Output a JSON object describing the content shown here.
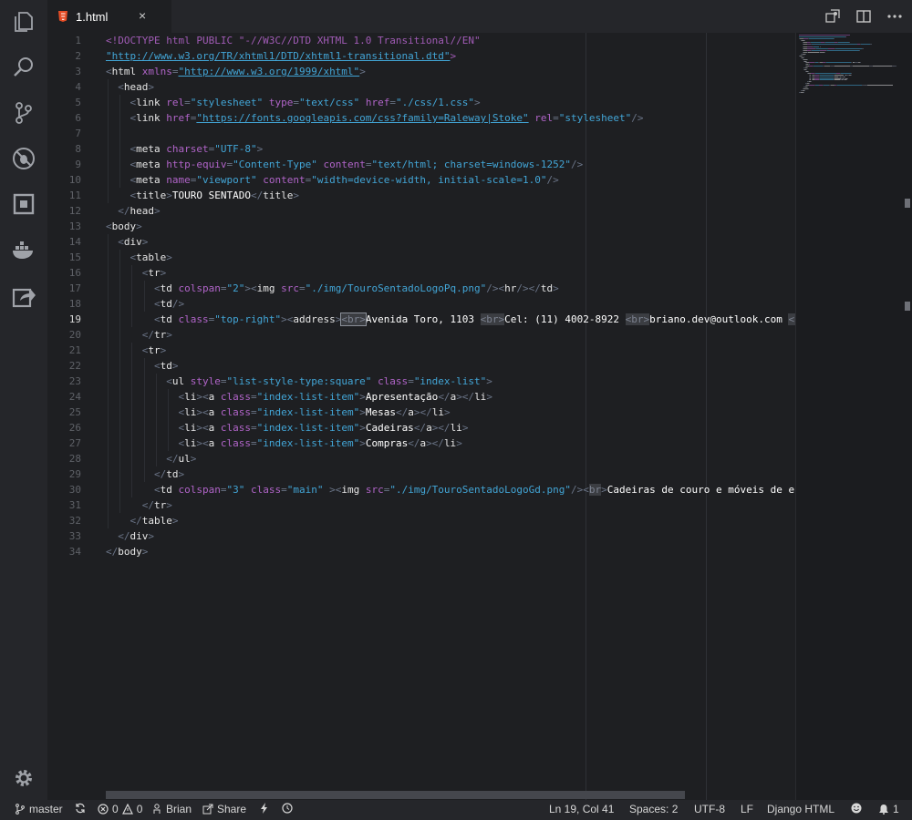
{
  "tab": {
    "label": "1.html",
    "close": "×"
  },
  "activity_icons": [
    "files-icon",
    "search-icon",
    "source-control-icon",
    "debug-icon",
    "extensions-icon",
    "docker-icon",
    "live-share-icon",
    "settings-gear-icon"
  ],
  "editor": {
    "active_line": 19,
    "line_numbers": [
      "1",
      "2",
      "3",
      "4",
      "5",
      "6",
      "7",
      "8",
      "9",
      "10",
      "11",
      "12",
      "13",
      "14",
      "15",
      "16",
      "17",
      "18",
      "19",
      "20",
      "21",
      "22",
      "23",
      "24",
      "25",
      "26",
      "27",
      "28",
      "29",
      "30",
      "31",
      "32",
      "33",
      "34"
    ],
    "lines": [
      [
        [
          "d",
          "<!DOCTYPE html PUBLIC \"-//W3C//DTD XHTML 1.0 Transitional//EN\""
        ]
      ],
      [
        [
          "u",
          "\"http://www.w3.org/TR/xhtml1/DTD/xhtml1-transitional.dtd\""
        ],
        [
          "d",
          ">"
        ]
      ],
      [
        [
          "t",
          "<"
        ],
        [
          "n",
          "html "
        ],
        [
          "a",
          "xmlns"
        ],
        [
          "t",
          "="
        ],
        [
          "u",
          "\"http://www.w3.org/1999/xhtml\""
        ],
        [
          "t",
          ">"
        ]
      ],
      [
        [
          "w",
          "  "
        ],
        [
          "t",
          "<"
        ],
        [
          "n",
          "head"
        ],
        [
          "t",
          ">"
        ]
      ],
      [
        [
          "w",
          "    "
        ],
        [
          "t",
          "<"
        ],
        [
          "n",
          "link "
        ],
        [
          "a",
          "rel"
        ],
        [
          "t",
          "="
        ],
        [
          "s",
          "\"stylesheet\" "
        ],
        [
          "a",
          "type"
        ],
        [
          "t",
          "="
        ],
        [
          "s",
          "\"text/css\" "
        ],
        [
          "a",
          "href"
        ],
        [
          "t",
          "="
        ],
        [
          "s",
          "\"./css/1.css\""
        ],
        [
          "t",
          ">"
        ]
      ],
      [
        [
          "w",
          "    "
        ],
        [
          "t",
          "<"
        ],
        [
          "n",
          "link "
        ],
        [
          "a",
          "href"
        ],
        [
          "t",
          "="
        ],
        [
          "u",
          "\"https://fonts.googleapis.com/css?family=Raleway|Stoke\""
        ],
        [
          "s",
          " "
        ],
        [
          "a",
          "rel"
        ],
        [
          "t",
          "="
        ],
        [
          "s",
          "\"stylesheet\""
        ],
        [
          "t",
          "/>"
        ]
      ],
      [],
      [
        [
          "w",
          "    "
        ],
        [
          "t",
          "<"
        ],
        [
          "n",
          "meta "
        ],
        [
          "a",
          "charset"
        ],
        [
          "t",
          "="
        ],
        [
          "s",
          "\"UTF-8\""
        ],
        [
          "t",
          ">"
        ]
      ],
      [
        [
          "w",
          "    "
        ],
        [
          "t",
          "<"
        ],
        [
          "n",
          "meta "
        ],
        [
          "a",
          "http-equiv"
        ],
        [
          "t",
          "="
        ],
        [
          "s",
          "\"Content-Type\" "
        ],
        [
          "a",
          "content"
        ],
        [
          "t",
          "="
        ],
        [
          "s",
          "\"text/html; charset=windows-1252\""
        ],
        [
          "t",
          "/>"
        ]
      ],
      [
        [
          "w",
          "    "
        ],
        [
          "t",
          "<"
        ],
        [
          "n",
          "meta "
        ],
        [
          "a",
          "name"
        ],
        [
          "t",
          "="
        ],
        [
          "s",
          "\"viewport\" "
        ],
        [
          "a",
          "content"
        ],
        [
          "t",
          "="
        ],
        [
          "s",
          "\"width=device-width, initial-scale=1.0\""
        ],
        [
          "t",
          "/>"
        ]
      ],
      [
        [
          "w",
          "    "
        ],
        [
          "t",
          "<"
        ],
        [
          "n",
          "title"
        ],
        [
          "t",
          ">"
        ],
        [
          "tx",
          "TOURO SENTADO"
        ],
        [
          "t",
          "</"
        ],
        [
          "n",
          "title"
        ],
        [
          "t",
          ">"
        ]
      ],
      [
        [
          "w",
          "  "
        ],
        [
          "t",
          "</"
        ],
        [
          "n",
          "head"
        ],
        [
          "t",
          ">"
        ]
      ],
      [
        [
          "t",
          "<"
        ],
        [
          "n",
          "body"
        ],
        [
          "t",
          ">"
        ]
      ],
      [
        [
          "w",
          "  "
        ],
        [
          "t",
          "<"
        ],
        [
          "n",
          "div"
        ],
        [
          "t",
          ">"
        ]
      ],
      [
        [
          "w",
          "    "
        ],
        [
          "t",
          "<"
        ],
        [
          "n",
          "table"
        ],
        [
          "t",
          ">"
        ]
      ],
      [
        [
          "w",
          "      "
        ],
        [
          "t",
          "<"
        ],
        [
          "n",
          "tr"
        ],
        [
          "t",
          ">"
        ]
      ],
      [
        [
          "w",
          "        "
        ],
        [
          "t",
          "<"
        ],
        [
          "n",
          "td "
        ],
        [
          "a",
          "colspan"
        ],
        [
          "t",
          "="
        ],
        [
          "s",
          "\"2\""
        ],
        [
          "t",
          ">"
        ],
        [
          "t",
          "<"
        ],
        [
          "n",
          "img "
        ],
        [
          "a",
          "src"
        ],
        [
          "t",
          "="
        ],
        [
          "s",
          "\"./img/TouroSentadoLogoPq.png\""
        ],
        [
          "t",
          "/>"
        ],
        [
          "t",
          "<"
        ],
        [
          "n",
          "hr"
        ],
        [
          "t",
          "/>"
        ],
        [
          "t",
          "</"
        ],
        [
          "n",
          "td"
        ],
        [
          "t",
          ">"
        ]
      ],
      [
        [
          "w",
          "        "
        ],
        [
          "t",
          "<"
        ],
        [
          "n",
          "td"
        ],
        [
          "t",
          "/>"
        ]
      ],
      [
        [
          "w",
          "        "
        ],
        [
          "t",
          "<"
        ],
        [
          "n",
          "td "
        ],
        [
          "a",
          "class"
        ],
        [
          "t",
          "="
        ],
        [
          "s",
          "\"top-right\""
        ],
        [
          "t",
          ">"
        ],
        [
          "t",
          "<"
        ],
        [
          "n",
          "address"
        ],
        [
          "t",
          ">"
        ],
        [
          "br2",
          "<br>"
        ],
        [
          "tx",
          "Avenida Toro, 1103 "
        ],
        [
          "br",
          "<br>"
        ],
        [
          "tx",
          "Cel: (11) 4002-8922 "
        ],
        [
          "br",
          "<br>"
        ],
        [
          "tx",
          "briano.dev@outlook.com "
        ],
        [
          "br",
          "<br>"
        ],
        [
          "t",
          "</"
        ]
      ],
      [
        [
          "w",
          "      "
        ],
        [
          "t",
          "</"
        ],
        [
          "n",
          "tr"
        ],
        [
          "t",
          ">"
        ]
      ],
      [
        [
          "w",
          "      "
        ],
        [
          "t",
          "<"
        ],
        [
          "n",
          "tr"
        ],
        [
          "t",
          ">"
        ]
      ],
      [
        [
          "w",
          "        "
        ],
        [
          "t",
          "<"
        ],
        [
          "n",
          "td"
        ],
        [
          "t",
          ">"
        ]
      ],
      [
        [
          "w",
          "          "
        ],
        [
          "t",
          "<"
        ],
        [
          "n",
          "ul "
        ],
        [
          "a",
          "style"
        ],
        [
          "t",
          "="
        ],
        [
          "s",
          "\"list-style-type:square\" "
        ],
        [
          "a",
          "class"
        ],
        [
          "t",
          "="
        ],
        [
          "s",
          "\"index-list\""
        ],
        [
          "t",
          ">"
        ]
      ],
      [
        [
          "w",
          "            "
        ],
        [
          "t",
          "<"
        ],
        [
          "n",
          "li"
        ],
        [
          "t",
          "><"
        ],
        [
          "n",
          "a "
        ],
        [
          "a",
          "class"
        ],
        [
          "t",
          "="
        ],
        [
          "s",
          "\"index-list-item\""
        ],
        [
          "t",
          ">"
        ],
        [
          "tx",
          "Apresentação"
        ],
        [
          "t",
          "</"
        ],
        [
          "n",
          "a"
        ],
        [
          "t",
          "></"
        ],
        [
          "n",
          "li"
        ],
        [
          "t",
          ">"
        ]
      ],
      [
        [
          "w",
          "            "
        ],
        [
          "t",
          "<"
        ],
        [
          "n",
          "li"
        ],
        [
          "t",
          "><"
        ],
        [
          "n",
          "a "
        ],
        [
          "a",
          "class"
        ],
        [
          "t",
          "="
        ],
        [
          "s",
          "\"index-list-item\""
        ],
        [
          "t",
          ">"
        ],
        [
          "tx",
          "Mesas"
        ],
        [
          "t",
          "</"
        ],
        [
          "n",
          "a"
        ],
        [
          "t",
          "></"
        ],
        [
          "n",
          "li"
        ],
        [
          "t",
          ">"
        ]
      ],
      [
        [
          "w",
          "            "
        ],
        [
          "t",
          "<"
        ],
        [
          "n",
          "li"
        ],
        [
          "t",
          "><"
        ],
        [
          "n",
          "a "
        ],
        [
          "a",
          "class"
        ],
        [
          "t",
          "="
        ],
        [
          "s",
          "\"index-list-item\""
        ],
        [
          "t",
          ">"
        ],
        [
          "tx",
          "Cadeiras"
        ],
        [
          "t",
          "</"
        ],
        [
          "n",
          "a"
        ],
        [
          "t",
          "></"
        ],
        [
          "n",
          "li"
        ],
        [
          "t",
          ">"
        ]
      ],
      [
        [
          "w",
          "            "
        ],
        [
          "t",
          "<"
        ],
        [
          "n",
          "li"
        ],
        [
          "t",
          "><"
        ],
        [
          "n",
          "a "
        ],
        [
          "a",
          "class"
        ],
        [
          "t",
          "="
        ],
        [
          "s",
          "\"index-list-item\""
        ],
        [
          "t",
          ">"
        ],
        [
          "tx",
          "Compras"
        ],
        [
          "t",
          "</"
        ],
        [
          "n",
          "a"
        ],
        [
          "t",
          "></"
        ],
        [
          "n",
          "li"
        ],
        [
          "t",
          ">"
        ]
      ],
      [
        [
          "w",
          "          "
        ],
        [
          "t",
          "</"
        ],
        [
          "n",
          "ul"
        ],
        [
          "t",
          ">"
        ]
      ],
      [
        [
          "w",
          "        "
        ],
        [
          "t",
          "</"
        ],
        [
          "n",
          "td"
        ],
        [
          "t",
          ">"
        ]
      ],
      [
        [
          "w",
          "        "
        ],
        [
          "t",
          "<"
        ],
        [
          "n",
          "td "
        ],
        [
          "a",
          "colspan"
        ],
        [
          "t",
          "="
        ],
        [
          "s",
          "\"3\" "
        ],
        [
          "a",
          "class"
        ],
        [
          "t",
          "="
        ],
        [
          "s",
          "\"main\" "
        ],
        [
          "t",
          "><"
        ],
        [
          "n",
          "img "
        ],
        [
          "a",
          "src"
        ],
        [
          "t",
          "="
        ],
        [
          "s",
          "\"./img/TouroSentadoLogoGd.png\""
        ],
        [
          "t",
          "/><"
        ],
        [
          "br",
          "br"
        ],
        [
          "t",
          ">"
        ],
        [
          "tx",
          "Cadeiras de couro e móveis de es"
        ]
      ],
      [
        [
          "w",
          "      "
        ],
        [
          "t",
          "</"
        ],
        [
          "n",
          "tr"
        ],
        [
          "t",
          ">"
        ]
      ],
      [
        [
          "w",
          "    "
        ],
        [
          "t",
          "</"
        ],
        [
          "n",
          "table"
        ],
        [
          "t",
          ">"
        ]
      ],
      [
        [
          "w",
          "  "
        ],
        [
          "t",
          "</"
        ],
        [
          "n",
          "div"
        ],
        [
          "t",
          ">"
        ]
      ],
      [
        [
          "t",
          "</"
        ],
        [
          "n",
          "body"
        ],
        [
          "t",
          ">"
        ]
      ]
    ]
  },
  "statusbar": {
    "branch": "master",
    "errors": "0",
    "warnings": "0",
    "user": "Brian",
    "share": "Share",
    "position": "Ln 19, Col 41",
    "spaces": "Spaces: 2",
    "encoding": "UTF-8",
    "eol": "LF",
    "language": "Django HTML",
    "notifications": "1"
  }
}
